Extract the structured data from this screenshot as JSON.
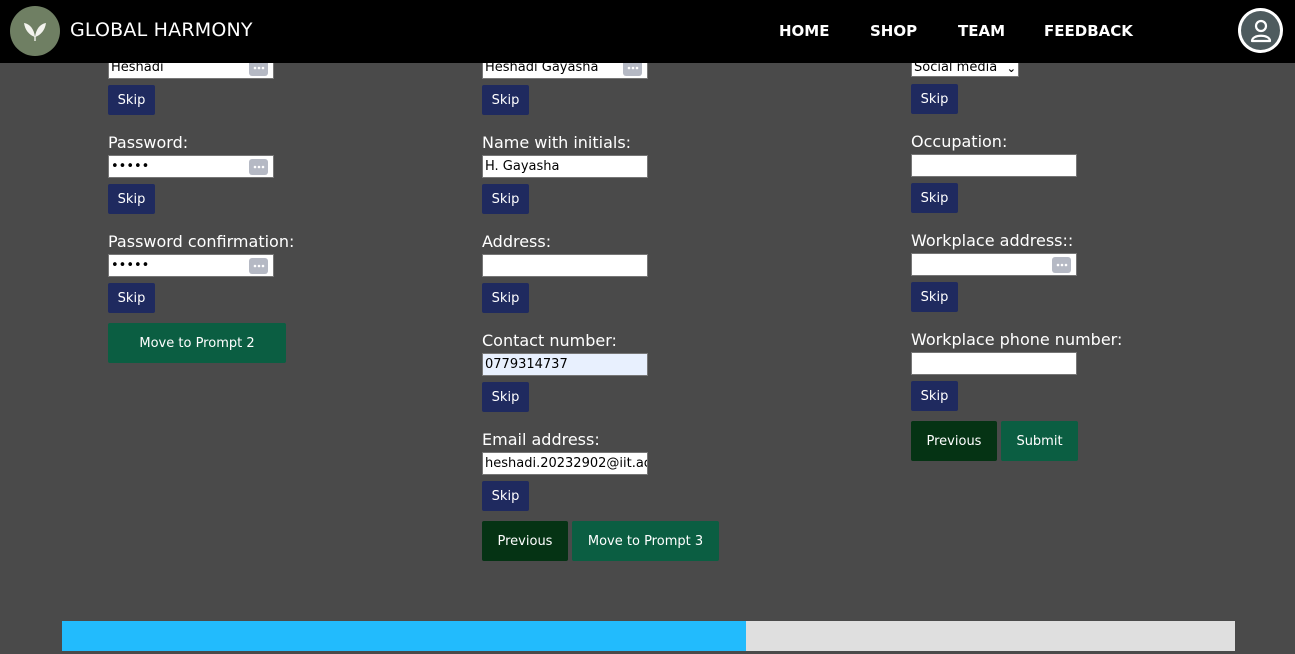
{
  "header": {
    "brand": "GLOBAL HARMONY",
    "nav": [
      "HOME",
      "SHOP",
      "TEAM",
      "FEEDBACK"
    ]
  },
  "prompt1": {
    "username_value": "Heshadi",
    "password_label": "Password:",
    "password_value": "•••••",
    "password_confirm_label": "Password confirmation:",
    "password_confirm_value": "•••••",
    "skip": "Skip",
    "next": "Move to Prompt 2"
  },
  "prompt2": {
    "full_name_value": "Heshadi Gayasha",
    "initials_label": "Name with initials:",
    "initials_value": "H. Gayasha",
    "address_label": "Address:",
    "address_value": "",
    "contact_label": "Contact number:",
    "contact_value": "0779314737",
    "email_label": "Email address:",
    "email_value": "heshadi.20232902@iit.ac",
    "skip": "Skip",
    "previous": "Previous",
    "next": "Move to Prompt 3"
  },
  "prompt3": {
    "source_value": "Social media",
    "occupation_label": "Occupation:",
    "occupation_value": "",
    "workplace_address_label": "Workplace address::",
    "workplace_address_value": "",
    "workplace_phone_label": "Workplace phone number:",
    "workplace_phone_value": "",
    "skip": "Skip",
    "previous": "Previous",
    "submit": "Submit"
  },
  "progress": {
    "fraction": 0.583
  },
  "colors": {
    "navbar": "#000000",
    "page_bg": "#4a4a4a",
    "skip_button": "#1f2a5f",
    "green_button": "#0b5e42",
    "previous_button": "#053314",
    "progress_fill": "#22bbfd",
    "progress_track": "#dfdfdf"
  },
  "icons": {
    "logo": "leaf-wings-logo",
    "profile": "user-icon",
    "field_menu": "ellipsis-icon",
    "select": "chevron-down-icon"
  }
}
